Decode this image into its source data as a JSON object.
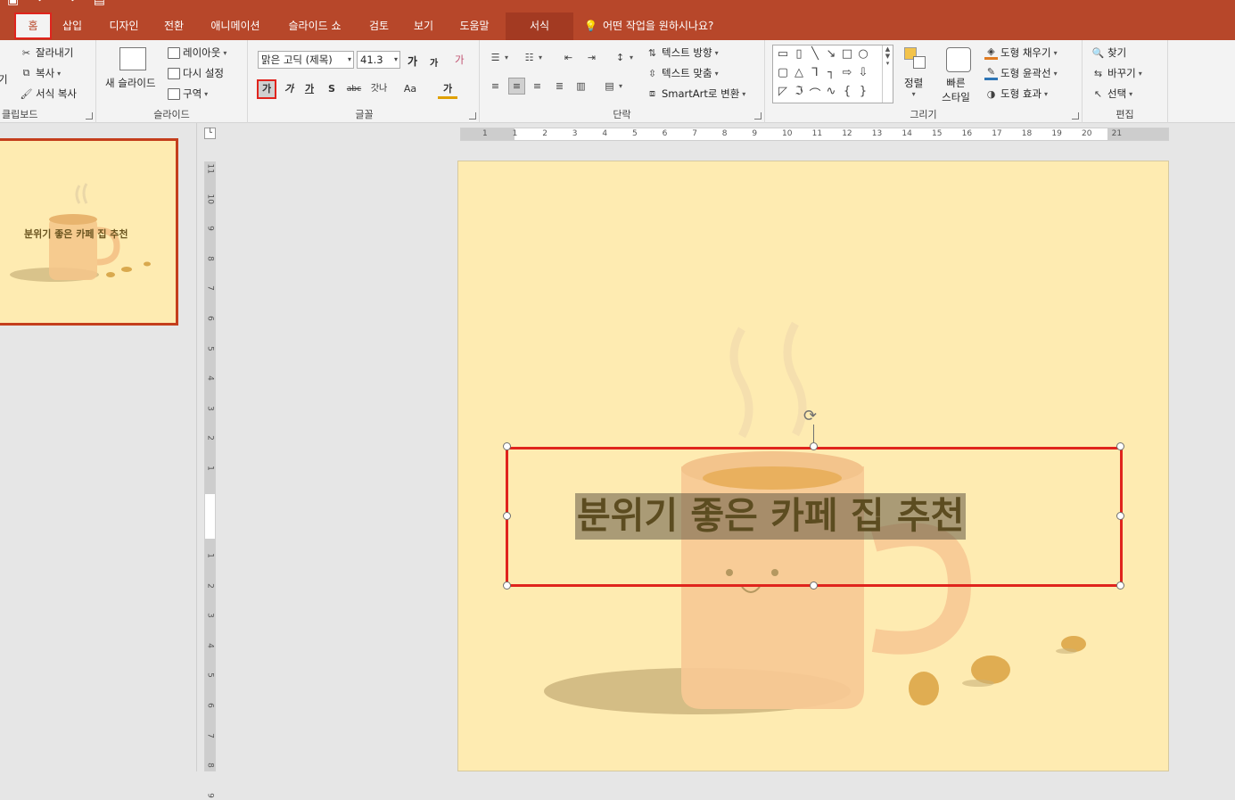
{
  "colors": {
    "accent": "#b7472a",
    "highlight": "#e0241d",
    "slide_bg": "#feebb1"
  },
  "tabs": [
    "홈",
    "삽입",
    "디자인",
    "전환",
    "애니메이션",
    "슬라이드 쇼",
    "검토",
    "보기",
    "도움말",
    "서식"
  ],
  "active_tab": "홈",
  "tell_me": "어떤 작업을 원하시나요?",
  "clipboard": {
    "cut": "잘라내기",
    "copy": "복사",
    "format_painter": "서식 복사",
    "paste_fragment": "기",
    "label": "클립보드"
  },
  "slides_group": {
    "new_slide": "새 슬라이드",
    "layout": "레이아웃",
    "reset": "다시 설정",
    "section": "구역",
    "label": "슬라이드"
  },
  "font_group": {
    "font_name": "맑은 고딕 (제목)",
    "font_size": "41.3",
    "grow": "가",
    "shrink": "가",
    "bold": "가",
    "italic": "가",
    "underline": "가",
    "shadow": "S",
    "strike": "abc",
    "spacing": "갓나",
    "case": "Aa",
    "color": "가",
    "clear": "가",
    "label": "글꼴"
  },
  "paragraph_group": {
    "text_direction": "텍스트 방향",
    "align_text": "텍스트 맞춤",
    "smartart": "SmartArt로 변환",
    "label": "단락"
  },
  "drawing_group": {
    "arrange": "정렬",
    "quick_styles": "빠른 스타일",
    "fill": "도형 채우기",
    "outline": "도형 윤곽선",
    "effects": "도형 효과",
    "label": "그리기"
  },
  "editing_group": {
    "find": "찾기",
    "replace": "바꾸기",
    "select": "선택",
    "label": "편집"
  },
  "ruler": {
    "h_ticks": [
      "1",
      "1",
      "2",
      "3",
      "4",
      "5",
      "6",
      "7",
      "8",
      "9",
      "10",
      "11",
      "12",
      "13",
      "14",
      "15",
      "16",
      "17",
      "18",
      "19",
      "20",
      "21"
    ],
    "v_ticks_up": [
      "11",
      "10",
      "9",
      "8",
      "7",
      "6",
      "5",
      "4",
      "3",
      "2",
      "1"
    ],
    "v_ticks_down": [
      "1",
      "2",
      "3",
      "4",
      "5",
      "6",
      "7",
      "8",
      "9"
    ]
  },
  "thumbnail": {
    "number": "",
    "title": "분위기 좋은 카페 집 추천"
  },
  "slide": {
    "title": "분위기 좋은 카페 집 추천"
  }
}
